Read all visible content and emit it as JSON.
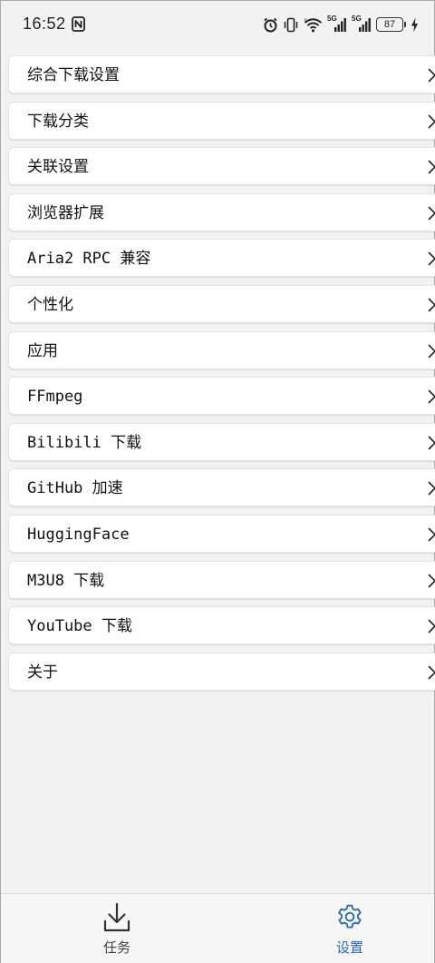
{
  "status_bar": {
    "time": "16:52",
    "network_1": "5G",
    "network_2": "5G",
    "battery": "87"
  },
  "settings": {
    "items": [
      {
        "label": "综合下载设置"
      },
      {
        "label": "下载分类"
      },
      {
        "label": "关联设置"
      },
      {
        "label": "浏览器扩展"
      },
      {
        "label": "Aria2 RPC 兼容"
      },
      {
        "label": "个性化"
      },
      {
        "label": "应用"
      },
      {
        "label": "FFmpeg"
      },
      {
        "label": "Bilibili 下载"
      },
      {
        "label": "GitHub 加速"
      },
      {
        "label": "HuggingFace"
      },
      {
        "label": "M3U8 下载"
      },
      {
        "label": "YouTube 下载"
      },
      {
        "label": "关于"
      }
    ]
  },
  "bottom_nav": {
    "tabs": [
      {
        "label": "任务",
        "icon": "download-icon",
        "active": false
      },
      {
        "label": "设置",
        "icon": "gear-icon",
        "active": true
      }
    ],
    "active_color": "#2a6aa8"
  }
}
